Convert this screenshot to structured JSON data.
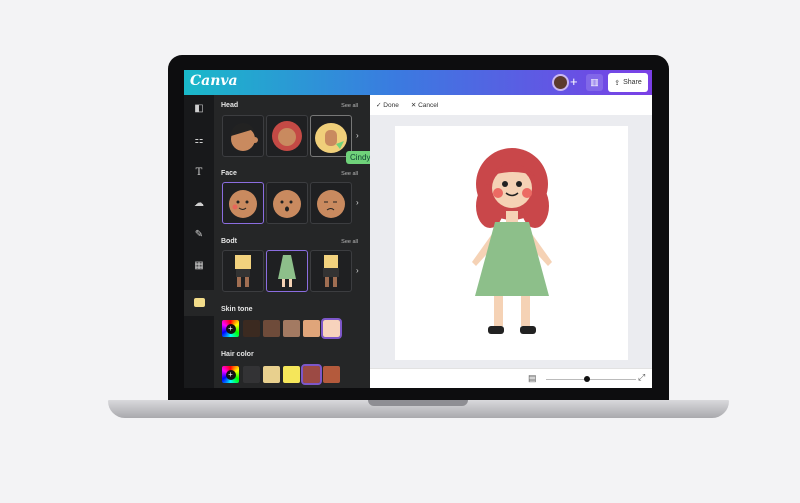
{
  "app": {
    "logo": "Canva"
  },
  "header": {
    "share_label": "Share",
    "plus": "+",
    "stats_icon": "chart-icon"
  },
  "toolbar": {
    "done": "Done",
    "cancel": "Cancel"
  },
  "panel": {
    "sections": [
      {
        "title": "Head",
        "see_all": "See all"
      },
      {
        "title": "Face",
        "see_all": "See all"
      },
      {
        "title": "Bodt",
        "see_all": "See all"
      }
    ],
    "skin_tone": {
      "title": "Skin tone",
      "colors": [
        "#3b2a20",
        "#6e4b3a",
        "#a37a62",
        "#e0a57a",
        "#f7d3bd"
      ],
      "selected": 4
    },
    "hair_color": {
      "title": "Hair color",
      "colors": [
        "#333335",
        "#e8d08e",
        "#f5e65a",
        "#9c4a44",
        "#b45a3c"
      ],
      "selected": 3
    }
  },
  "cursor_label": "Cindy",
  "colors": {
    "accent": "#7b3fe6",
    "teal": "#1ab9c9",
    "cursor": "#6fd27a"
  }
}
